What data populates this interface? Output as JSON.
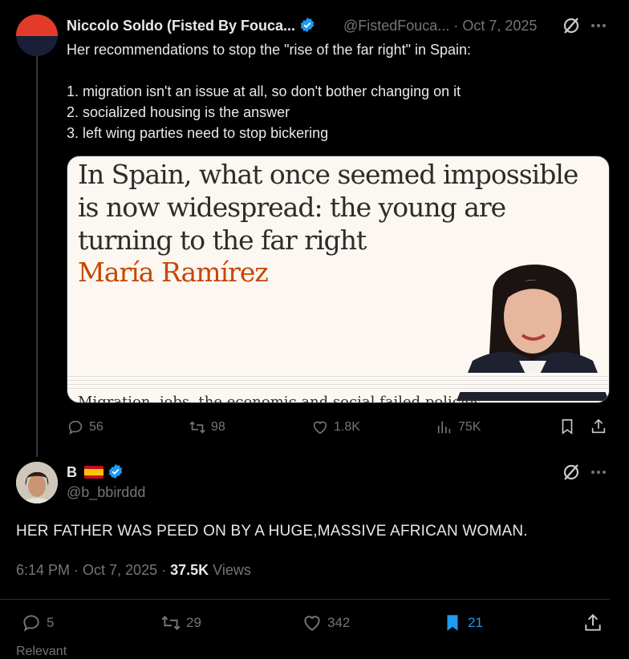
{
  "original_tweet": {
    "display_name": "Niccolo Soldo (Fisted By Fouca...",
    "handle": "@FistedFouca...",
    "date": "· Oct 7, 2025",
    "intro": "Her recommendations to stop the \"rise of the far right\" in Spain:",
    "points": [
      "1. migration isn't an issue at all, so don't bother changing on it",
      "2. socialized housing is the answer",
      "3. left wing parties need to stop bickering"
    ],
    "card": {
      "headline": "In Spain, what once seemed impossible is now widespread: the young are turning to the far right",
      "author": "María Ramírez",
      "cut_line": "Migration, jobs, the economic and social failed policies"
    },
    "stats": {
      "replies": "56",
      "reposts": "98",
      "likes": "1.8K",
      "views": "75K"
    }
  },
  "reply_tweet": {
    "display_name": "B",
    "handle": "@b_bbirddd",
    "text": "HER FATHER WAS PEED ON BY A HUGE,MASSIVE AFRICAN WOMAN.",
    "time": "6:14 PM · Oct 7, 2025 ·",
    "views_count": "37.5K",
    "views_label": "Views",
    "stats": {
      "replies": "5",
      "reposts": "29",
      "likes": "342",
      "bookmarks": "21"
    }
  },
  "colors": {
    "accent": "#1d9bf0",
    "background": "#000000",
    "text": "#e7e9ea",
    "muted": "#71767b",
    "author_orange": "#c74600",
    "card_bg": "#fcf7f1"
  },
  "bottom_cut": "Relevant"
}
